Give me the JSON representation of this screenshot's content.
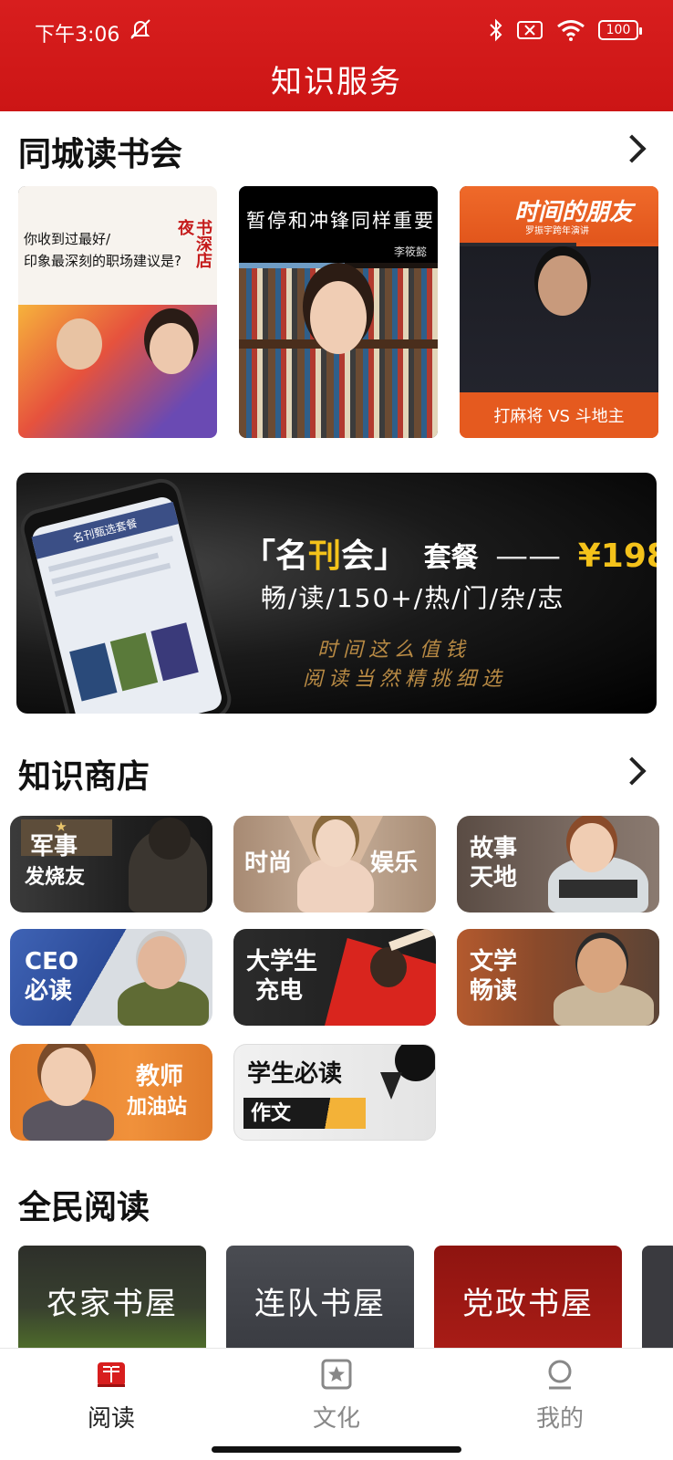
{
  "status_bar": {
    "time": "下午3:06",
    "battery": "100"
  },
  "header": {
    "title": "知识服务"
  },
  "book_club": {
    "title": "同城读书会",
    "cards": [
      {
        "line1": "你收到过最好/",
        "line2": "印象最深刻的职场建议是?",
        "badge": "书深店夜"
      },
      {
        "caption": "暂停和冲锋同样重要",
        "author": "李筱懿"
      },
      {
        "logo": "时间的朋友",
        "logo_sub": "罗振宇跨年演讲",
        "caption": "打麻将 VS 斗地主"
      }
    ]
  },
  "banner": {
    "bracket_open": "「",
    "name_a": "名",
    "name_b": "刊",
    "name_c": "会",
    "bracket_close": "」",
    "package": "套餐",
    "dash": "——",
    "price": "¥198",
    "subtitle": "畅/读/150+/热/门/杂/志",
    "slogan1": "时间这么值钱",
    "slogan2": "阅读当然精挑细选",
    "phone_title": "名刊甄选套餐"
  },
  "shop": {
    "title": "知识商店",
    "tiles": [
      {
        "line1": "军事",
        "line2": "发烧友"
      },
      {
        "line1": "时尚",
        "line2": "娱乐"
      },
      {
        "line1": "故事",
        "line2": "天地"
      },
      {
        "line1": "CEO",
        "line2": "必读"
      },
      {
        "line1": "大学生",
        "line2": "充电"
      },
      {
        "line1": "文学",
        "line2": "畅读"
      },
      {
        "line1": "教师",
        "line2": "加油站"
      },
      {
        "line1": "学生必读",
        "line2": "作文"
      }
    ]
  },
  "national_reading": {
    "title": "全民阅读",
    "items": [
      "农家书屋",
      "连队书屋",
      "党政书屋"
    ]
  },
  "tabs": [
    {
      "label": "阅读",
      "icon": "book-icon",
      "active": true
    },
    {
      "label": "文化",
      "icon": "star-icon",
      "active": false
    },
    {
      "label": "我的",
      "icon": "profile-icon",
      "active": false
    }
  ],
  "colors": {
    "brand_red": "#d81e1e",
    "gold": "#f4c21a"
  }
}
